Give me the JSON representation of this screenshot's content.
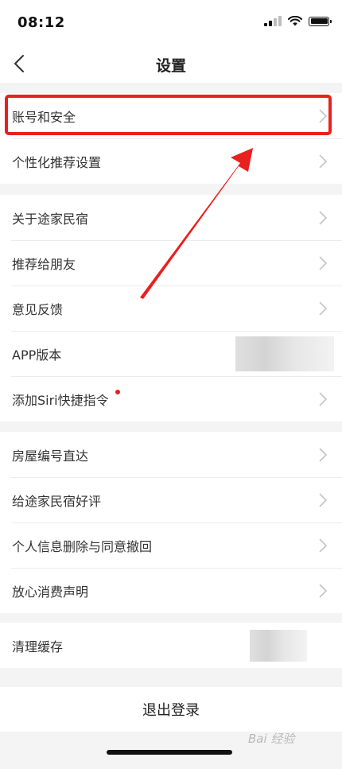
{
  "status_bar": {
    "time": "08:12"
  },
  "nav": {
    "title": "设置",
    "back_icon": "chevron-left-icon"
  },
  "sections": [
    {
      "items": [
        {
          "label": "账号和安全"
        },
        {
          "label": "个性化推荐设置"
        }
      ]
    },
    {
      "items": [
        {
          "label": "关于途家民宿"
        },
        {
          "label": "推荐给朋友"
        },
        {
          "label": "意见反馈"
        },
        {
          "label": "APP版本"
        },
        {
          "label": "添加Siri快捷指令"
        }
      ]
    },
    {
      "items": [
        {
          "label": "房屋编号直达"
        },
        {
          "label": "给途家民宿好评"
        },
        {
          "label": "个人信息删除与同意撤回"
        },
        {
          "label": "放心消费声明"
        }
      ]
    },
    {
      "items": [
        {
          "label": "清理缓存"
        }
      ]
    }
  ],
  "logout": {
    "label": "退出登录"
  },
  "watermark": {
    "text": "Bai 经验"
  },
  "colors": {
    "highlight": "#e8201e",
    "badge_dot": "#e02020"
  }
}
